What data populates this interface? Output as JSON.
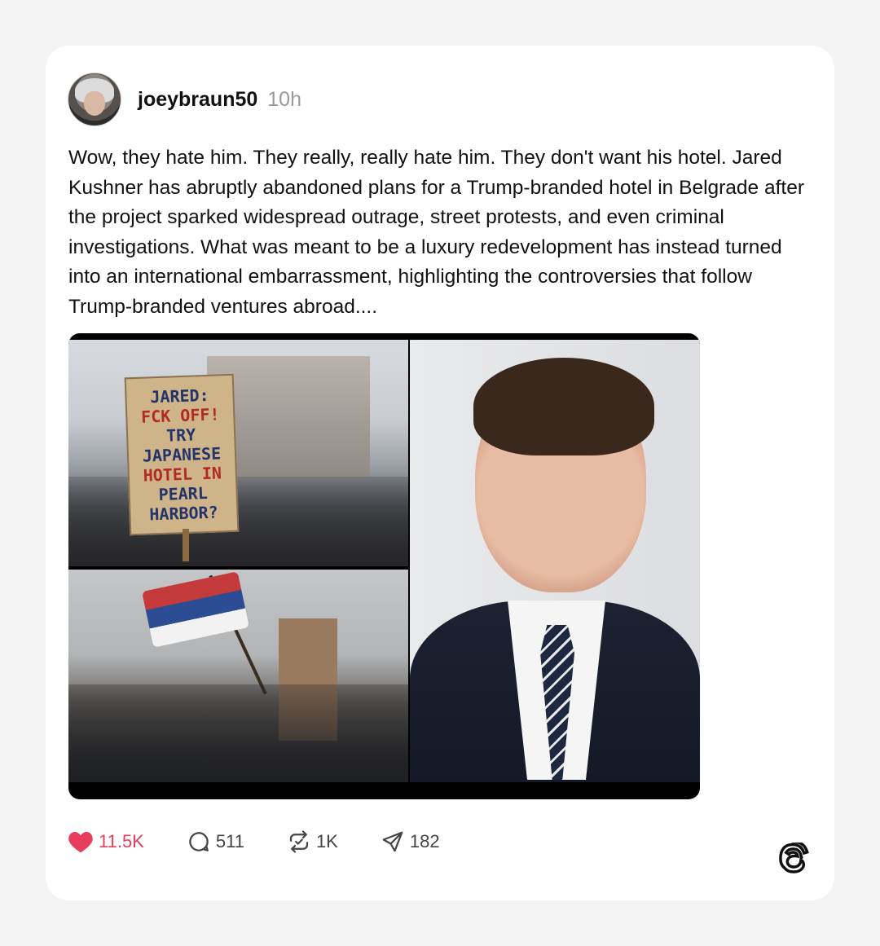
{
  "post": {
    "username": "joeybraun50",
    "time": "10h",
    "text": "Wow, they hate him. They really, really hate him. They don't want his hotel. Jared Kushner has abruptly abandoned plans for a Trump-branded hotel in Belgrade after the project sparked widespread outrage, street protests, and even criminal investigations. What was meant to be a luxury redevelopment has instead turned into an international embarrassment, highlighting the controversies that follow Trump-branded ventures abroad....",
    "sign_text": [
      "JARED:",
      "FCK OFF!",
      "TRY JAPANESE",
      "HOTEL IN",
      "PEARL",
      "HARBOR?"
    ]
  },
  "actions": {
    "likes": "11.5K",
    "replies": "511",
    "reposts": "1K",
    "shares": "182"
  },
  "colors": {
    "like": "#e63e5c",
    "muted": "#9a9a9a",
    "text": "#111111",
    "card": "#ffffff",
    "page": "#f4f4f4"
  },
  "icons": [
    "heart-icon",
    "comment-icon",
    "repost-icon",
    "share-icon",
    "threads-logo-icon"
  ]
}
